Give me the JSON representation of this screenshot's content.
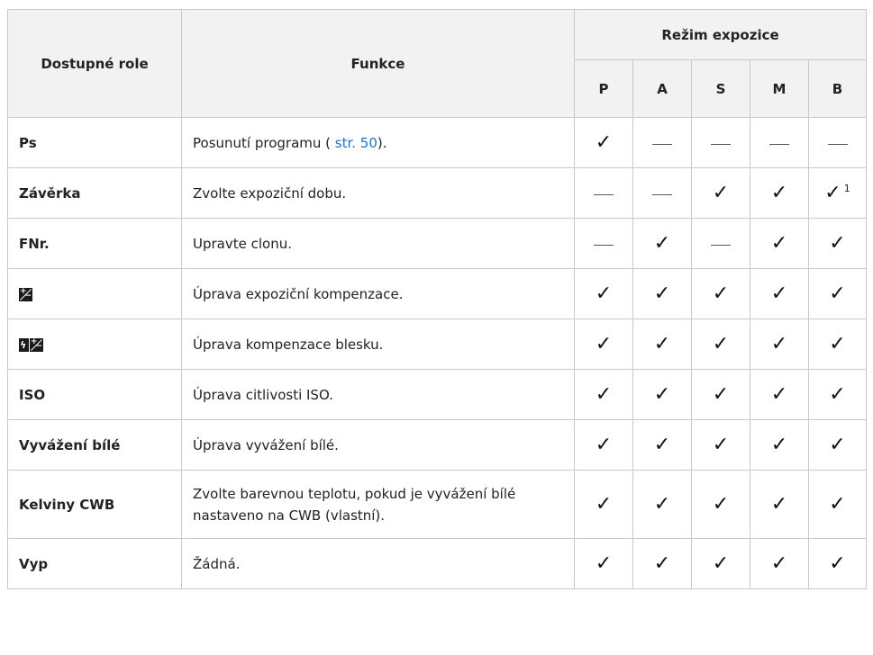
{
  "header": {
    "role_col": "Dostupné role",
    "func_col": "Funkce",
    "exposure_group": "Režim expozice",
    "modes": [
      "P",
      "A",
      "S",
      "M",
      "B"
    ]
  },
  "rows": [
    {
      "role": "Ps",
      "func_before": "Posunutí programu ( ",
      "link": "str. 50",
      "func_after": ").",
      "marks": [
        "check",
        "dash",
        "dash",
        "dash",
        "dash"
      ]
    },
    {
      "role": "Závěrka",
      "func": "Zvolte expoziční dobu.",
      "marks": [
        "dash",
        "dash",
        "check",
        "check",
        "check"
      ],
      "footnote": "1"
    },
    {
      "role": "FNr.",
      "func": "Upravte clonu.",
      "marks": [
        "dash",
        "check",
        "dash",
        "check",
        "check"
      ]
    },
    {
      "role_icon": "exposure-compensation-icon",
      "func": "Úprava expoziční kompenzace.",
      "marks": [
        "check",
        "check",
        "check",
        "check",
        "check"
      ]
    },
    {
      "role_icon": "flash-compensation-icon",
      "func": "Úprava kompenzace blesku.",
      "marks": [
        "check",
        "check",
        "check",
        "check",
        "check"
      ]
    },
    {
      "role": "ISO",
      "func": "Úprava citlivosti ISO.",
      "marks": [
        "check",
        "check",
        "check",
        "check",
        "check"
      ]
    },
    {
      "role": "Vyvážení bílé",
      "func": "Úprava vyvážení bílé.",
      "marks": [
        "check",
        "check",
        "check",
        "check",
        "check"
      ]
    },
    {
      "role": "Kelviny CWB",
      "func": "Zvolte barevnou teplotu, pokud je vyvážení bílé nastaveno na CWB (vlastní).",
      "marks": [
        "check",
        "check",
        "check",
        "check",
        "check"
      ]
    },
    {
      "role": "Vyp",
      "func": "Žádná.",
      "marks": [
        "check",
        "check",
        "check",
        "check",
        "check"
      ]
    }
  ],
  "symbols": {
    "check": "✓",
    "link_color": "#1a73c8"
  }
}
